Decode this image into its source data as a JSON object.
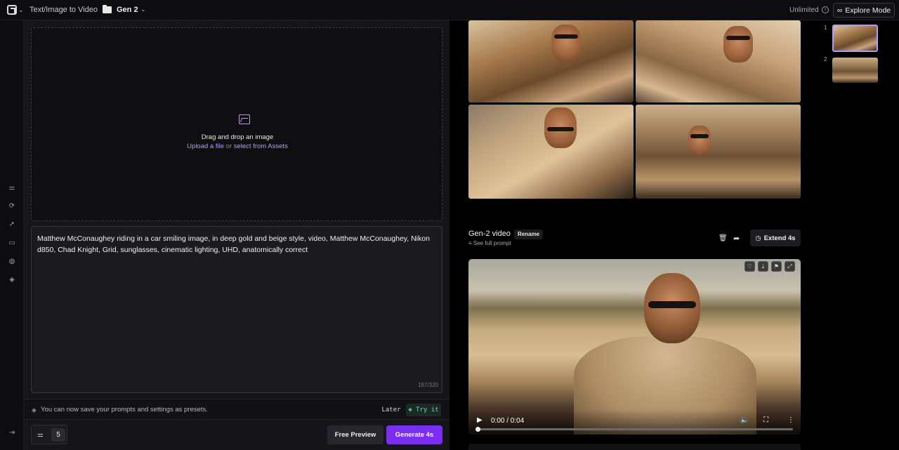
{
  "topbar": {
    "mode_title": "Text/Image to Video",
    "project_name": "Gen 2",
    "plan_label": "Unlimited",
    "explore_label": "Explore Mode",
    "explore_icon": "infinity-icon"
  },
  "sidebar": {
    "icons": [
      "sliders-icon",
      "motion-icon",
      "rocket-icon",
      "rectangle-icon",
      "palette-icon",
      "layers-icon"
    ],
    "collapse_icon": "collapse-right-icon"
  },
  "upload": {
    "drag_text": "Drag and drop an image",
    "upload_link": "Upload a file",
    "or_text": "or",
    "assets_link": "select from Assets"
  },
  "prompt": {
    "text": "Matthew McConaughey riding in a car smiling image, in deep gold and beige style, video, Matthew McConaughey, Nikon d850, Chad Knight, Grid, sunglasses, cinematic lighting, UHD, anatomically correct",
    "counter": "197/320"
  },
  "presets_banner": {
    "text": "You can now save your prompts and settings as presets.",
    "later_label": "Later",
    "try_label": "Try it"
  },
  "actions": {
    "count_value": "5",
    "free_preview_label": "Free Preview",
    "generate_label": "Generate 4s"
  },
  "result": {
    "title": "Gen-2 video",
    "rename_label": "Rename",
    "full_prompt_label": "See full prompt",
    "extend_label": "Extend 4s",
    "time_display": "0:00 / 0:04",
    "progress": 0.0
  },
  "thumbnails": {
    "numbers": [
      "1",
      "2"
    ],
    "selected_index": 0
  },
  "colors": {
    "accent_purple": "#7a2ff0",
    "link_purple": "#b39df0",
    "try_green": "#5fe0a8"
  }
}
